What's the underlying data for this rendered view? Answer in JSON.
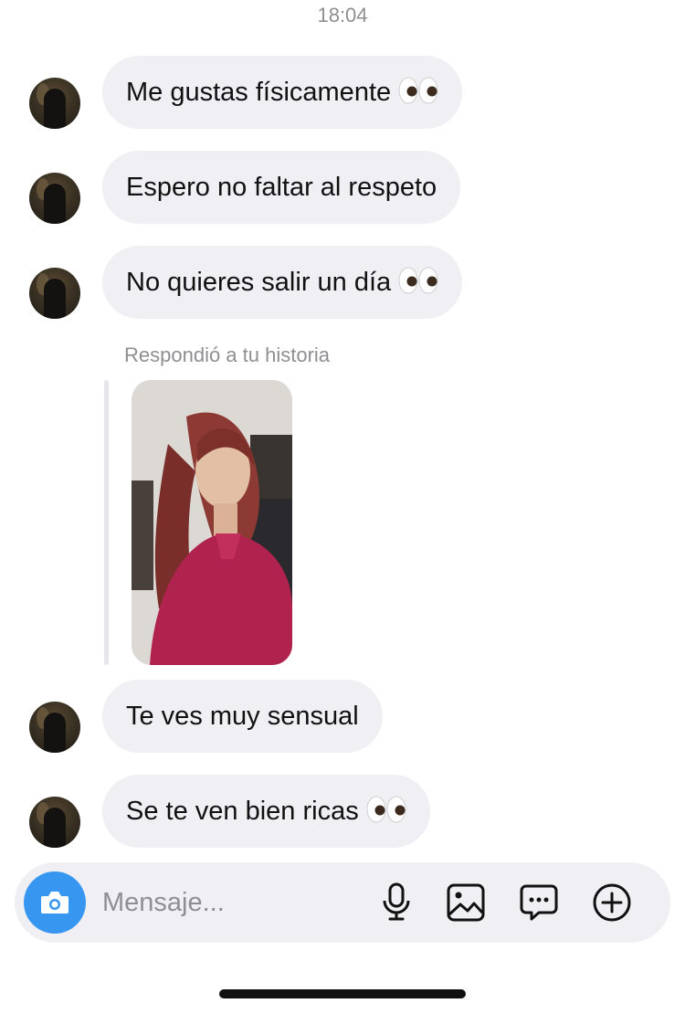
{
  "timestamp": "18:04",
  "messages": [
    {
      "text": "Me gustas físicamente",
      "emoji": "eyes"
    },
    {
      "text": "Espero no faltar al respeto",
      "emoji": ""
    },
    {
      "text": "No quieres salir un día",
      "emoji": "eyes"
    },
    {
      "text": "Te ves muy sensual",
      "emoji": ""
    },
    {
      "text": "Se te ven bien ricas",
      "emoji": "eyes"
    }
  ],
  "story_reply": {
    "label": "Respondió a tu historia"
  },
  "composer": {
    "placeholder": "Mensaje...",
    "icons": [
      "camera-icon",
      "microphone-icon",
      "image-icon",
      "sticker-chat-icon",
      "plus-icon"
    ]
  },
  "colors": {
    "accent": "#3797f0",
    "bubble": "#efeff4",
    "muted": "#8e8e93"
  }
}
